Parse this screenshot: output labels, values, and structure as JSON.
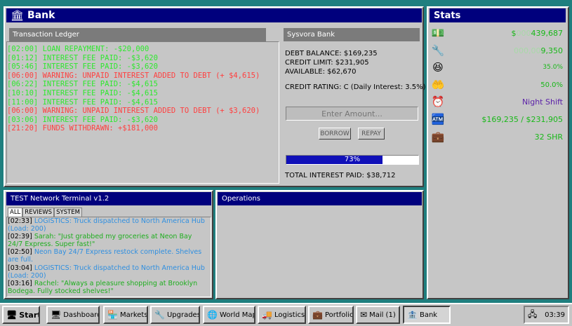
{
  "bank_window": {
    "title": "Bank",
    "ledger_header": "Transaction Ledger",
    "ledger": [
      {
        "text": "[02:00] LOAN REPAYMENT: -$20,000",
        "kind": "ok"
      },
      {
        "text": "[01:12] INTEREST FEE PAID: -$3,620",
        "kind": "ok"
      },
      {
        "text": "[05:46] INTEREST FEE PAID: -$3,620",
        "kind": "ok"
      },
      {
        "text": "[06:00] WARNING: UNPAID INTEREST ADDED TO DEBT (+ $4,615)",
        "kind": "warn"
      },
      {
        "text": "[06:22] INTEREST FEE PAID: -$4,615",
        "kind": "ok"
      },
      {
        "text": "[10:10] INTEREST FEE PAID: -$4,615",
        "kind": "ok"
      },
      {
        "text": "[11:00] INTEREST FEE PAID: -$4,615",
        "kind": "ok"
      },
      {
        "text": "[06:00] WARNING: UNPAID INTEREST ADDED TO DEBT (+ $3,620)",
        "kind": "warn"
      },
      {
        "text": "[03:06] INTEREST FEE PAID: -$3,620",
        "kind": "ok"
      },
      {
        "text": "[21:20] FUNDS WITHDRAWN: +$181,000",
        "kind": "warn"
      }
    ],
    "bank_header": "Sysvora Bank",
    "debt_balance": "DEBT BALANCE: $169,235",
    "credit_limit": "CREDIT LIMIT: $231,905",
    "available": "AVAILABLE: $62,670",
    "credit_rating": "CREDIT RATING: C (Daily Interest: 3.5%)",
    "amount_placeholder": "Enter Amount...",
    "borrow_label": "BORROW",
    "repay_label": "REPAY",
    "usage_percent": 73,
    "usage_label": "73%",
    "total_interest": "TOTAL INTEREST PAID: $38,712"
  },
  "terminal_window": {
    "title": "TEST Network Terminal v1.2",
    "tabs": [
      "ALL",
      "REVIEWS",
      "SYSTEM"
    ],
    "feed": [
      {
        "time": "[02:33]",
        "text": " LOGISTICS: Truck dispatched to North America Hub (Load: 200)",
        "kind": "log"
      },
      {
        "time": "[02:39]",
        "text": " Sarah: \"Just grabbed my groceries at Neon Bay 24/7 Express. Super fast!\"",
        "kind": "rev"
      },
      {
        "time": "[02:50]",
        "text": " Neon Bay 24/7 Express restock complete. Shelves are full.",
        "kind": "log"
      },
      {
        "time": "[03:04]",
        "text": " LOGISTICS: Truck dispatched to North America Hub (Load: 200)",
        "kind": "log"
      },
      {
        "time": "[03:16]",
        "text": " Rachel: \"Always a pleasure shopping at Brooklyn Bodega. Fully stocked shelves!\"",
        "kind": "rev"
      }
    ]
  },
  "operations_window": {
    "title": "Operations"
  },
  "stats_window": {
    "title": "Stats",
    "cash_prefix": "$",
    "cash_dim": "000",
    "cash": "439,687",
    "count_dim": "000,00",
    "count": "9,350",
    "happiness": "35.0%",
    "demand": "50.0%",
    "shift": "Night Shift",
    "debt": "$169,235 / $231,905",
    "shares": "32 SHR",
    "colors": {
      "green": "#18b818",
      "purple": "#5a1fa8",
      "dim_green": "#a8d8a8"
    }
  },
  "taskbar": {
    "start": "Start",
    "items": [
      "Dashboard",
      "Markets",
      "Upgrades",
      "World Map",
      "Logistics",
      "Portfolio",
      "Mail (1)",
      "Bank"
    ],
    "clock": "03:39"
  }
}
